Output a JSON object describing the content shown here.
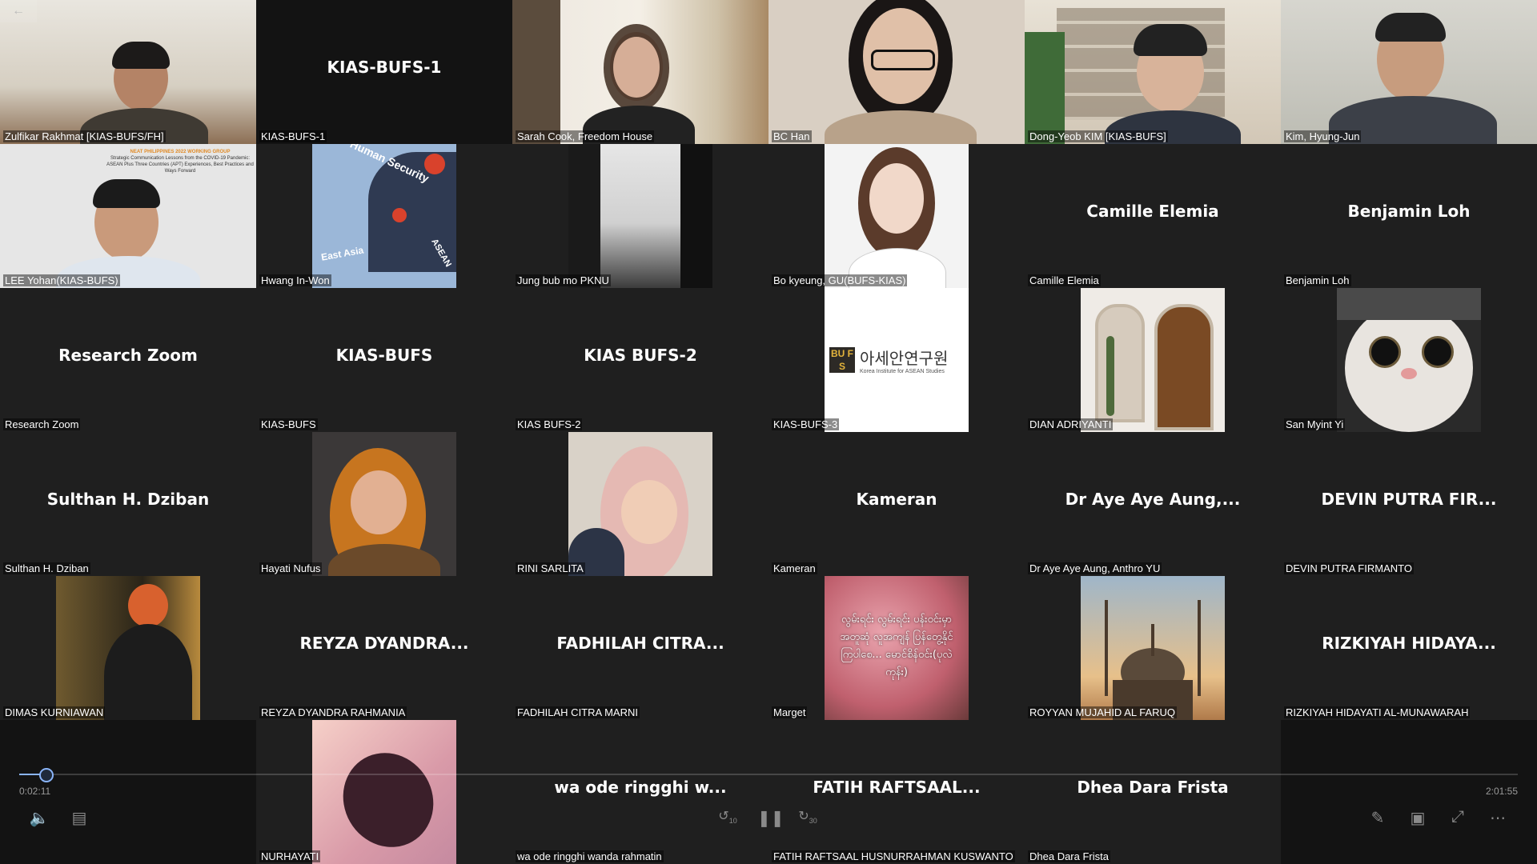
{
  "tiles": [
    {
      "label": "Zulfikar Rakhmat [KIAS-BUFS/FH]",
      "type": "video"
    },
    {
      "label": "KIAS-BUFS-1",
      "big": "KIAS-BUFS-1",
      "type": "name"
    },
    {
      "label": "Sarah Cook, Freedom House",
      "type": "video"
    },
    {
      "label": "BC Han",
      "type": "video"
    },
    {
      "label": "Dong-Yeob KIM [KIAS-BUFS]",
      "type": "video"
    },
    {
      "label": "Kim, Hyung-Jun",
      "type": "video"
    },
    {
      "label": "LEE Yohan(KIAS-BUFS)",
      "type": "video"
    },
    {
      "label": "Hwang In-Won",
      "type": "avatar"
    },
    {
      "label": "Jung bub mo PKNU",
      "type": "avatar"
    },
    {
      "label": "Bo kyeung, GU(BUFS-KIAS)",
      "type": "avatar"
    },
    {
      "label": "Camille Elemia",
      "big": "Camille Elemia",
      "type": "name"
    },
    {
      "label": "Benjamin Loh",
      "big": "Benjamin Loh",
      "type": "name"
    },
    {
      "label": "Research Zoom",
      "big": "Research Zoom",
      "type": "name"
    },
    {
      "label": "KIAS-BUFS",
      "big": "KIAS-BUFS",
      "type": "name"
    },
    {
      "label": "KIAS BUFS-2",
      "big": "KIAS BUFS-2",
      "type": "name"
    },
    {
      "label": "KIAS-BUFS-3",
      "type": "avatar"
    },
    {
      "label": "DIAN ADRIYANTI",
      "type": "avatar"
    },
    {
      "label": "San Myint Yi",
      "type": "avatar"
    },
    {
      "label": "Sulthan H. Dziban",
      "big": "Sulthan H. Dziban",
      "type": "name"
    },
    {
      "label": "Hayati Nufus",
      "type": "avatar"
    },
    {
      "label": "RINI SARLITA",
      "type": "avatar"
    },
    {
      "label": "Kameran",
      "big": "Kameran",
      "type": "name"
    },
    {
      "label": "Dr Aye Aye Aung, Anthro YU",
      "big": "Dr Aye Aye Aung,...",
      "type": "name"
    },
    {
      "label": "DEVIN PUTRA FIRMANTO",
      "big": "DEVIN PUTRA FIR...",
      "type": "name"
    },
    {
      "label": "DIMAS KURNIAWAN",
      "type": "avatar"
    },
    {
      "label": "REYZA DYANDRA RAHMANIA",
      "big": "REYZA DYANDRA...",
      "type": "name"
    },
    {
      "label": "FADHILAH CITRA MARNI",
      "big": "FADHILAH CITRA...",
      "type": "name"
    },
    {
      "label": "Marget",
      "type": "avatar"
    },
    {
      "label": "ROYYAN MUJAHID AL FARUQ",
      "type": "avatar"
    },
    {
      "label": "RIZKIYAH HIDAYATI AL-MUNAWARAH",
      "big": "RIZKIYAH HIDAYA...",
      "type": "name"
    },
    {
      "label": "",
      "type": "empty"
    },
    {
      "label": "NURHAYATI",
      "type": "avatar"
    },
    {
      "label": "wa ode ringghi wanda rahmatin",
      "big": "wa ode ringghi w...",
      "type": "name"
    },
    {
      "label": "FATIH RAFTSAAL HUSNURRAHMAN KUSWANTO",
      "big": "FATIH RAFTSAAL...",
      "type": "name"
    },
    {
      "label": "Dhea Dara Frista",
      "big": "Dhea Dara Frista",
      "type": "name"
    },
    {
      "label": "",
      "type": "empty"
    }
  ],
  "avatar_text": {
    "hwang_1": "Human Security",
    "hwang_2": "East Asia",
    "hwang_3": "ASEAN",
    "kias3_logo": "BU FS",
    "kias3_title": "아세안연구원",
    "kias3_sub": "Korea Institute for ASEAN Studies",
    "marget_text": "လွမ်းရင်း လွမ်းရင်း ပန်းဝင်းမှာ အတူဆုံ လူအကျန် ပြန်တွေ့နိုင်ကြပါစေ... မောင်စိန်ဝင်း(ပုလဲကုန်း)",
    "lee_banner_1": "NEAT PHILIPPINES 2022 WORKING GROUP",
    "lee_banner_2": "Strategic Communication Lessons from the COVID-19 Pandemic: ASEAN Plus Three Countries (APT) Experiences, Best Practices and Ways Forward"
  },
  "player": {
    "elapsed": "0:02:11",
    "total": "2:01:55",
    "progress": 0.018,
    "back_icon": "arrow-left-icon",
    "volume_icon": "speaker-icon",
    "captions_icon": "captions-icon",
    "rewind_label": "10",
    "forward_label": "30",
    "pause_icon": "pause-icon",
    "edit_icon": "pencil-icon",
    "miniplayer_icon": "miniplayer-icon",
    "exit_fullscreen_icon": "exit-fullscreen-icon",
    "more_icon": "more-icon"
  },
  "colors": {
    "tile_bg": "#1f1f1f",
    "accent": "#8ab4f8"
  }
}
